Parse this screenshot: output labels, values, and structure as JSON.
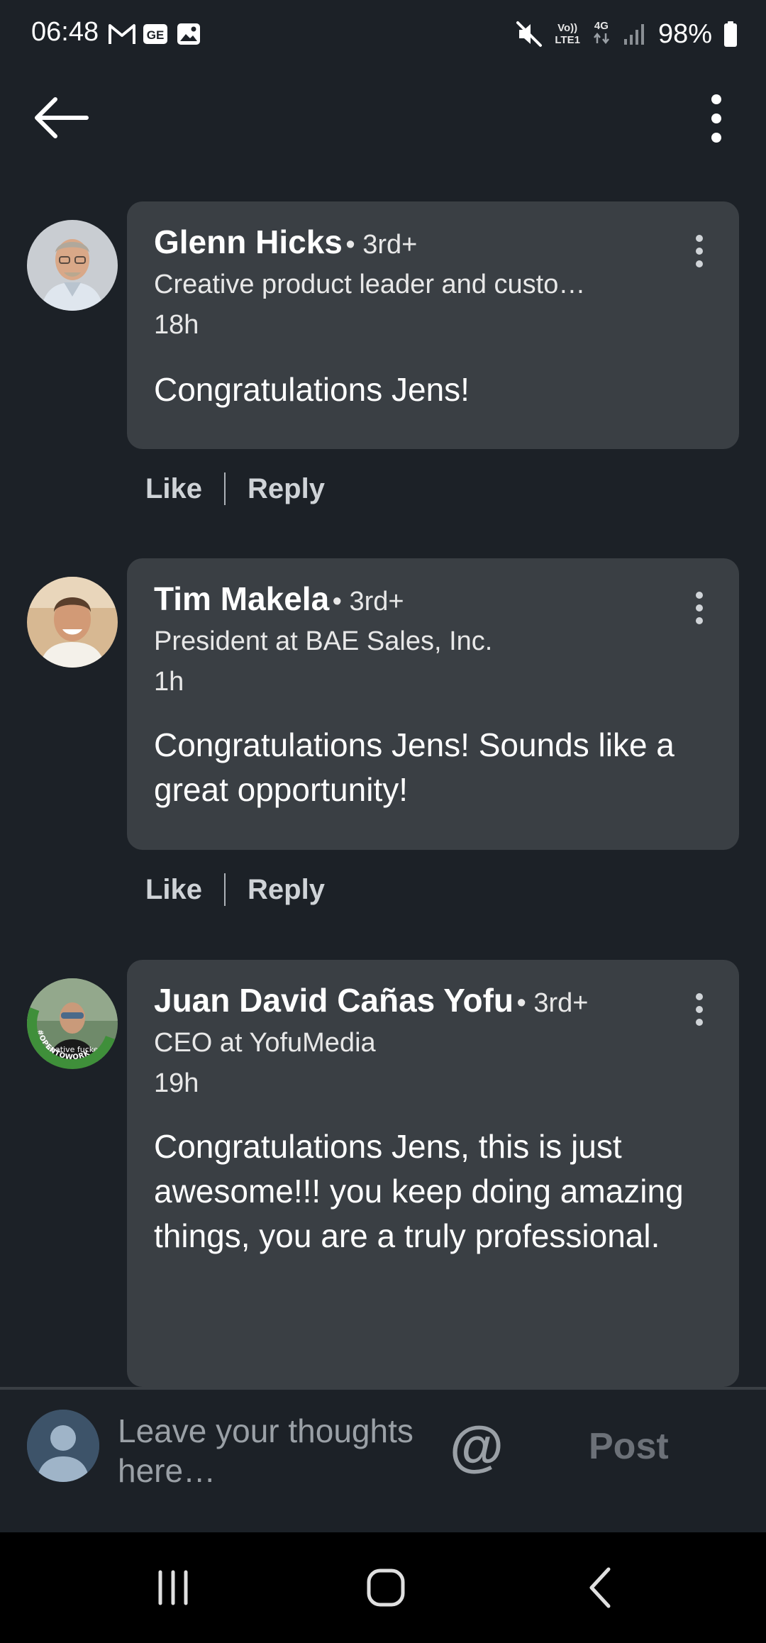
{
  "status_bar": {
    "time": "06:48",
    "battery": "98%",
    "net_top": "Vo))",
    "net_bottom": "LTE1",
    "net_type": "4G",
    "icons": [
      "gmail-icon",
      "message-icon",
      "gallery-icon",
      "mute-icon",
      "signal-icon",
      "battery-icon"
    ]
  },
  "app_bar": {
    "back_icon": "arrow-left-icon",
    "menu_icon": "more-vertical-icon"
  },
  "comments": [
    {
      "name": "Glenn Hicks",
      "degree": "• 3rd+",
      "headline": "Creative product leader and custo…",
      "time": "18h",
      "text": "Congratulations Jens!",
      "like_label": "Like",
      "reply_label": "Reply"
    },
    {
      "name": "Tim Makela",
      "degree": "• 3rd+",
      "headline": "President at BAE Sales, Inc.",
      "time": "1h",
      "text": "Congratulations Jens! Sounds like a great opportunity!",
      "like_label": "Like",
      "reply_label": "Reply"
    },
    {
      "name": "Juan David Cañas Yofu",
      "degree": "• 3rd+",
      "headline": "CEO at YofuMedia",
      "time": "19h",
      "text": "Congratulations Jens, this is just awesome!!! you keep doing amazing things, you are a truly professional.",
      "avatar_badge": "#OPENTOWORK",
      "shirt_text": "creative fucker"
    }
  ],
  "composer": {
    "placeholder": "Leave your thoughts here…",
    "mention_symbol": "@",
    "post_label": "Post"
  },
  "colors": {
    "background": "#1c2127",
    "bubble": "#3a3f44",
    "nav_bar": "#000000",
    "open_to_work": "#3f8f3a"
  }
}
